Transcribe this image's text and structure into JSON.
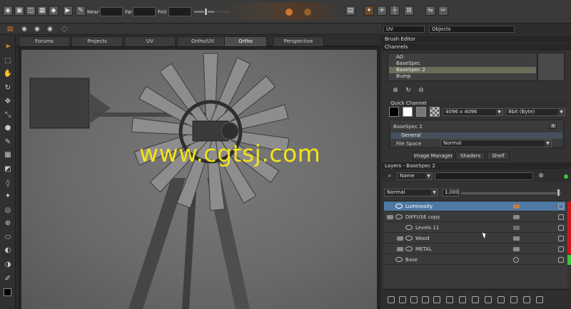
{
  "toolbar": {
    "near_label": "Near",
    "far_label": "Far",
    "fov_label": "FoV"
  },
  "view_tabs": [
    {
      "label": "Forums"
    },
    {
      "label": "Projects"
    },
    {
      "label": "UV"
    },
    {
      "label": "Ortho/UV"
    },
    {
      "label": "Ortho",
      "active": true
    },
    {
      "label": "Perspective"
    }
  ],
  "right_top": {
    "dropdown_left": "UV",
    "dropdown_right": "Objects"
  },
  "brush_editor": {
    "title": "Brush Editor",
    "channels_title": "Channels",
    "channels": [
      "AO",
      "BaseSpec",
      "BaseSpec 2",
      "Bump"
    ],
    "selected_channel": "BaseSpec 2",
    "quick_channel_title": "Quick Channel",
    "resolution": "4096 x 4096",
    "bit_depth": "8bit (Byte)",
    "channel_name": "BaseSpec 2",
    "general_label": "General",
    "file_space_label": "File Space",
    "file_space_value": "Normal"
  },
  "sub_tabs": [
    "Image Manager",
    "Shaders",
    "Shelf"
  ],
  "layers_panel": {
    "title": "Layers - BaseSpec 2",
    "filter_dropdown": "Name",
    "blend_mode": "Normal",
    "opacity": "1.000",
    "layers": [
      {
        "name": "Luminosity",
        "indent": 0,
        "selected": true
      },
      {
        "name": "DIFFUSE copy",
        "indent": 0,
        "selected": false
      },
      {
        "name": "Levels 11",
        "indent": 1,
        "selected": false
      },
      {
        "name": "Wood",
        "indent": 1,
        "selected": false
      },
      {
        "name": "METAL",
        "indent": 1,
        "selected": false
      },
      {
        "name": "Base",
        "indent": 0,
        "selected": false
      }
    ]
  },
  "watermark": "www.cgtsj.com",
  "colors": {
    "accent_selected": "#4f78a3",
    "watermark": "#f3e11b",
    "red_bar": "#d41515",
    "green_bar": "#3cc43c"
  }
}
